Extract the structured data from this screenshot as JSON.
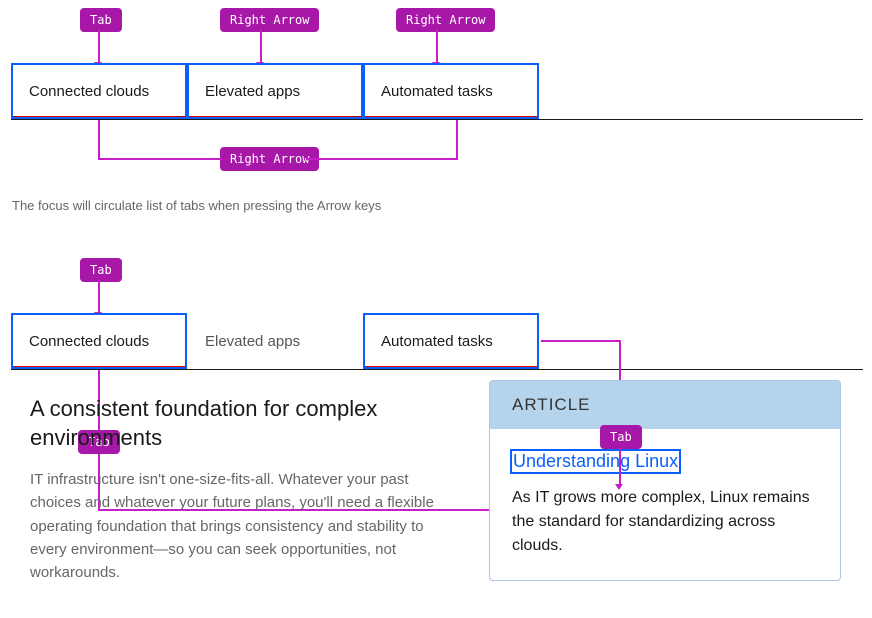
{
  "badges": {
    "tab1": "Tab",
    "ra1": "Right Arrow",
    "ra2": "Right Arrow",
    "ra3": "Right Arrow",
    "tab2": "Tab",
    "tab3": "Tab",
    "tab4": "Tab"
  },
  "tabs1": {
    "t0": "Connected clouds",
    "t1": "Elevated apps",
    "t2": "Automated tasks"
  },
  "tabs2": {
    "t0": "Connected clouds",
    "t1": "Elevated apps",
    "t2": "Automated tasks"
  },
  "caption": "The focus will circulate list of tabs when pressing the Arrow keys",
  "panel": {
    "heading": "A consistent foundation for complex environments",
    "body": "IT infrastructure isn't one-size-fits-all. Whatever your past choices and whatever your future plans, you'll need a flexible operating foundation that brings consistency and stability to every environment—so you can seek opportunities, not workarounds."
  },
  "card": {
    "label": "ARTICLE",
    "link": "Understanding Linux",
    "body": "As IT grows more complex, Linux remains the standard for standardizing across clouds."
  }
}
